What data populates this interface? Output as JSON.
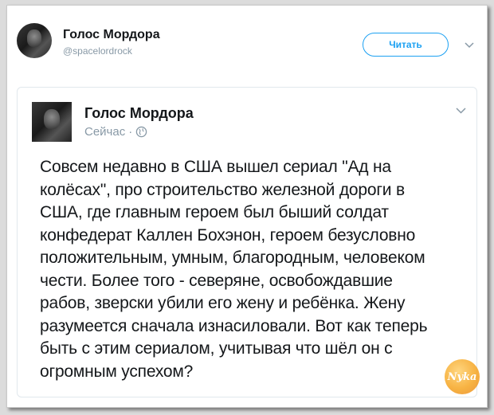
{
  "tweet": {
    "author_name": "Голос Мордора",
    "author_handle": "@spacelordrock",
    "follow_label": "Читать",
    "chevron_icon": "chevron-down-icon"
  },
  "quoted": {
    "author_name": "Голос Мордора",
    "time_label": "Сейчас",
    "separator": "·",
    "visibility_icon": "globe-icon",
    "text_lines": [
      "Совсем недавно в США вышел сериал \"Ад на",
      "колёсах\", про строительство железной дороги в",
      "США, где главным героем был быший солдат",
      "конфедерат Каллен Бохэнон, героем безусловно",
      "положительным, умным, благородным, человеком",
      "чести. Более того - северяне, освобождавшие",
      "рабов, зверски убили его жену и ребёнка. Жену",
      "разумеется сначала изнасиловали. Вот как теперь",
      "быть с этим сериалом, учитывая что шёл он с",
      "огромным успехом?"
    ]
  },
  "watermark": {
    "text": "Nyka"
  },
  "colors": {
    "accent": "#1da1f2",
    "text": "#14171a",
    "muted": "#8899a6"
  }
}
